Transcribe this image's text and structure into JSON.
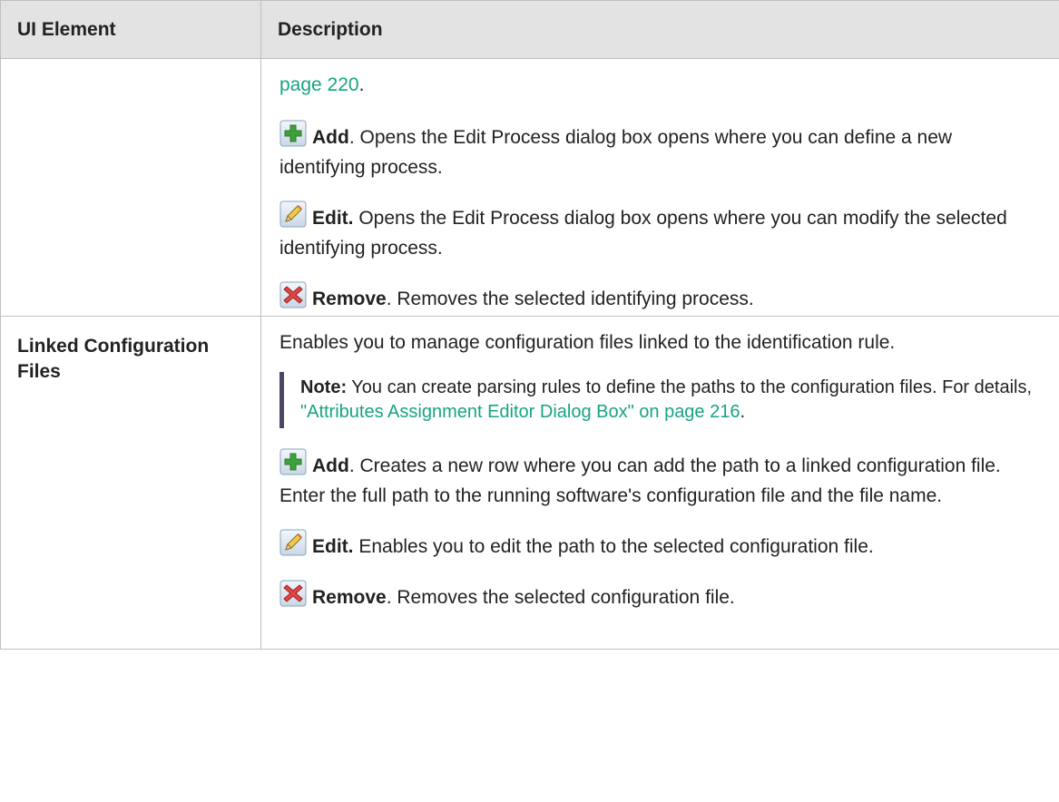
{
  "header": {
    "col_element": "UI Element",
    "col_description": "Description"
  },
  "row1": {
    "link_text": "page 220",
    "link_suffix": ".",
    "add": {
      "label": "Add",
      "text": ". Opens the Edit Process dialog box opens where you can define a new identifying process."
    },
    "edit": {
      "label": "Edit.",
      "text": " Opens the Edit Process dialog box opens where you can modify the selected identifying process."
    },
    "remove": {
      "label": "Remove",
      "text": ". Removes the selected identifying process."
    }
  },
  "row2": {
    "element_name": "Linked Configuration Files",
    "intro": "Enables you to manage configuration files linked to the identification rule.",
    "note": {
      "label": "Note:",
      "text": "  You can create parsing rules to define the paths to the configuration files. For details, ",
      "link_text": "\"Attributes Assignment Editor Dialog Box\" on page 216",
      "suffix": "."
    },
    "add": {
      "label": "Add",
      "text": ". Creates a new row where you can add the path to a linked configuration file. Enter the full path to the running software's configuration file and the file name."
    },
    "edit": {
      "label": "Edit.",
      "text": " Enables you to edit the path to the selected configuration file."
    },
    "remove": {
      "label": "Remove",
      "text": ". Removes the selected configuration file."
    }
  },
  "icons": {
    "add": "add-icon",
    "edit": "edit-pencil-icon",
    "remove": "remove-x-icon"
  },
  "colors": {
    "link": "#17a384",
    "header_bg": "#e3e3e3",
    "note_bar": "#4b4566",
    "border": "#c0c0c0"
  }
}
